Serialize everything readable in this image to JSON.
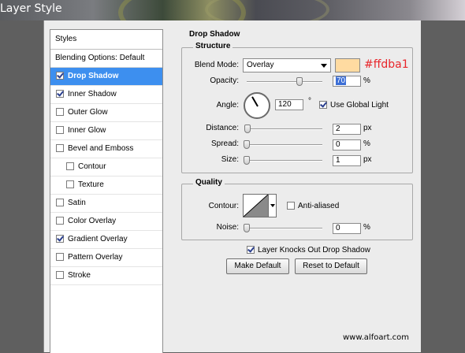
{
  "window": {
    "title": "Layer Style"
  },
  "styles_panel": {
    "header": "Styles",
    "blending_options": "Blending Options: Default",
    "items": [
      {
        "label": "Drop Shadow",
        "checked": true,
        "active": true,
        "indent": false
      },
      {
        "label": "Inner Shadow",
        "checked": true,
        "active": false,
        "indent": false
      },
      {
        "label": "Outer Glow",
        "checked": false,
        "active": false,
        "indent": false
      },
      {
        "label": "Inner Glow",
        "checked": false,
        "active": false,
        "indent": false
      },
      {
        "label": "Bevel and Emboss",
        "checked": false,
        "active": false,
        "indent": false
      },
      {
        "label": "Contour",
        "checked": false,
        "active": false,
        "indent": true
      },
      {
        "label": "Texture",
        "checked": false,
        "active": false,
        "indent": true
      },
      {
        "label": "Satin",
        "checked": false,
        "active": false,
        "indent": false
      },
      {
        "label": "Color Overlay",
        "checked": false,
        "active": false,
        "indent": false
      },
      {
        "label": "Gradient Overlay",
        "checked": true,
        "active": false,
        "indent": false
      },
      {
        "label": "Pattern Overlay",
        "checked": false,
        "active": false,
        "indent": false
      },
      {
        "label": "Stroke",
        "checked": false,
        "active": false,
        "indent": false
      }
    ]
  },
  "drop_shadow": {
    "heading": "Drop Shadow",
    "structure": {
      "title": "Structure",
      "blend_mode_label": "Blend Mode:",
      "blend_mode_value": "Overlay",
      "color": "#ffdba1",
      "color_annotation": "#ffdba1",
      "annotation_color": "#e8262b",
      "opacity_label": "Opacity:",
      "opacity_value": "70",
      "opacity_unit": "%",
      "angle_label": "Angle:",
      "angle_value": "120",
      "angle_unit": "°",
      "use_global_light_label": "Use Global Light",
      "use_global_light": true,
      "distance_label": "Distance:",
      "distance_value": "2",
      "distance_unit": "px",
      "spread_label": "Spread:",
      "spread_value": "0",
      "spread_unit": "%",
      "size_label": "Size:",
      "size_value": "1",
      "size_unit": "px"
    },
    "quality": {
      "title": "Quality",
      "contour_label": "Contour:",
      "anti_aliased_label": "Anti-aliased",
      "anti_aliased": false,
      "noise_label": "Noise:",
      "noise_value": "0",
      "noise_unit": "%"
    },
    "layer_knocks_out_label": "Layer Knocks Out Drop Shadow",
    "layer_knocks_out": true,
    "make_default_label": "Make Default",
    "reset_default_label": "Reset to Default"
  },
  "watermark": "www.alfoart.com"
}
